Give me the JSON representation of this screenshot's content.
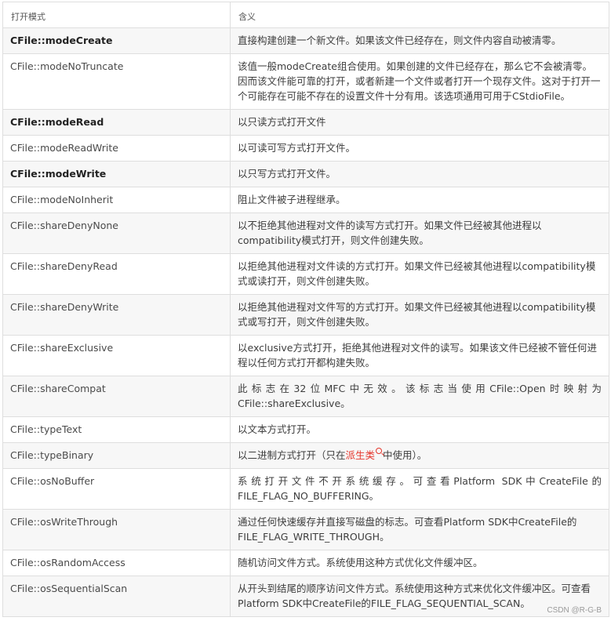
{
  "header": {
    "col_mode": "打开模式",
    "col_meaning": "含义"
  },
  "rows": [
    {
      "name": "CFile::modeCreate",
      "desc": "直接构建创建一个新文件。如果该文件已经存在，则文件内容自动被清零。"
    },
    {
      "name": "CFile::modeNoTruncate",
      "desc": "该值一般modeCreate组合使用。如果创建的文件已经存在，那么它不会被清零。因而该文件能可靠的打开，或者新建一个文件或者打开一个现存文件。这对于打开一个可能存在可能不存在的设置文件十分有用。该选项通用可用于CStdioFile。"
    },
    {
      "name": "CFile::modeRead",
      "desc": "以只读方式打开文件"
    },
    {
      "name": "CFile::modeReadWrite",
      "desc": "以可读可写方式打开文件。"
    },
    {
      "name": "CFile::modeWrite",
      "desc": "以只写方式打开文件。"
    },
    {
      "name": "CFile::modeNoInherit",
      "desc": "阻止文件被子进程继承。"
    },
    {
      "name": "CFile::shareDenyNone",
      "desc": "以不拒绝其他进程对文件的读写方式打开。如果文件已经被其他进程以compatibility模式打开，则文件创建失败。"
    },
    {
      "name": "CFile::shareDenyRead",
      "desc": "以拒绝其他进程对文件读的方式打开。如果文件已经被其他进程以compatibility模式或读打开，则文件创建失败。"
    },
    {
      "name": "CFile::shareDenyWrite",
      "desc": "以拒绝其他进程对文件写的方式打开。如果文件已经被其他进程以compatibility模式或写打开，则文件创建失败。"
    },
    {
      "name": "CFile::shareExclusive",
      "desc": "以exclusive方式打开，拒绝其他进程对文件的读写。如果该文件已经被不管任何进程以任何方式打开都构建失败。"
    },
    {
      "name": "CFile::shareCompat",
      "desc": "此标志在32位MFC中无效。该标志当使用CFile::Open时映射为CFile::shareExclusive。"
    },
    {
      "name": "CFile::typeText",
      "desc": "以文本方式打开。"
    },
    {
      "name": "CFile::typeBinary",
      "desc_before": "以二进制方式打开（只在",
      "desc_link": "派生类",
      "desc_after": "中使用）。"
    },
    {
      "name": "CFile::osNoBuffer",
      "desc": "系统打开文件不开系统缓存。可查看Platform SDK中CreateFile的FILE_FLAG_NO_BUFFERING。"
    },
    {
      "name": "CFile::osWriteThrough",
      "desc": "通过任何快速缓存并直接写磁盘的标志。可查看Platform SDK中CreateFile的FILE_FLAG_WRITE_THROUGH。"
    },
    {
      "name": "CFile::osRandomAccess",
      "desc": "随机访问文件方式。系统使用这种方式优化文件缓冲区。"
    },
    {
      "name": "CFile::osSequentialScan",
      "desc": "从开头到结尾的顺序访问文件方式。系统使用这种方式来优化文件缓冲区。可查看Platform SDK中CreateFile的FILE_FLAG_SEQUENTIAL_SCAN。"
    }
  ],
  "watermark": "CSDN @R-G-B"
}
